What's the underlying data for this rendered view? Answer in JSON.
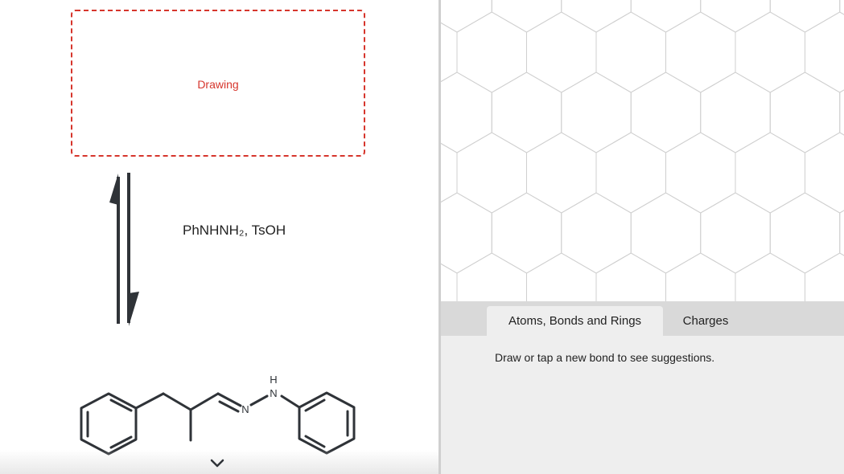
{
  "drawing_box": {
    "label": "Drawing"
  },
  "reaction": {
    "reagent": "PhNHNH₂, TsOH"
  },
  "product_structure": {
    "atom_labels": [
      "H",
      "N",
      "N"
    ]
  },
  "editor": {
    "tabs": [
      {
        "label": "Atoms, Bonds and Rings",
        "active": true
      },
      {
        "label": "Charges",
        "active": false
      }
    ],
    "hint": "Draw or tap a new bond to see suggestions."
  },
  "colors": {
    "accent": "#d6352c",
    "bond": "#2f3338",
    "grid": "#cfcfcf"
  }
}
